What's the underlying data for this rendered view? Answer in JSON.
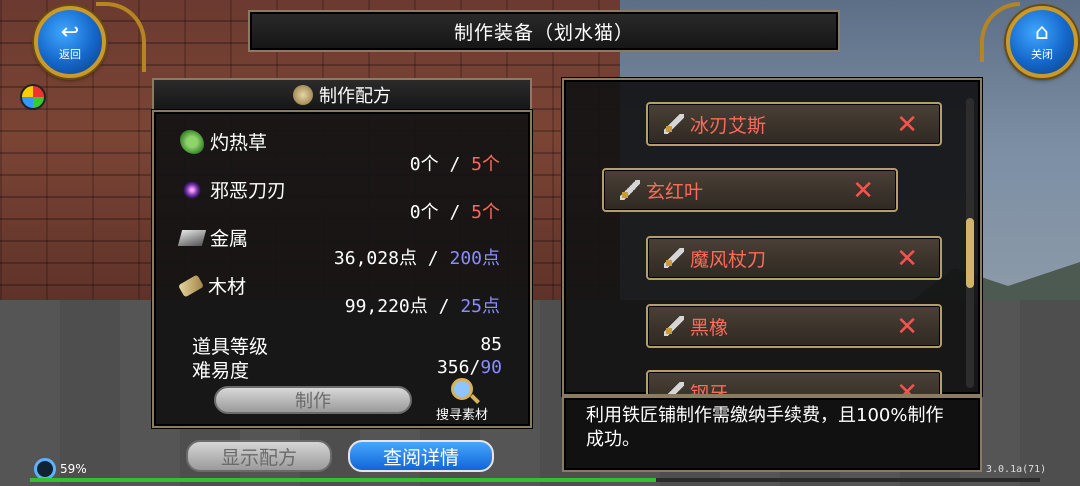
{
  "header": {
    "title": "制作装备（划水猫）"
  },
  "nav": {
    "back_label": "返回",
    "close_label": "关闭"
  },
  "recipe": {
    "title": "制作配方",
    "materials": [
      {
        "name": "灼热草",
        "have": "0个",
        "need": "5个",
        "icon": "herb-icon",
        "need_color": "red"
      },
      {
        "name": "邪恶刀刃",
        "have": "0个",
        "need": "5个",
        "icon": "evil-blade-icon",
        "need_color": "red"
      },
      {
        "name": "金属",
        "have": "36,028点",
        "need": "200点",
        "icon": "metal-icon",
        "need_color": "blue"
      },
      {
        "name": "木材",
        "have": "99,220点",
        "need": "25点",
        "icon": "wood-icon",
        "need_color": "blue"
      }
    ],
    "item_level_label": "道具等级",
    "item_level_value": "85",
    "difficulty_label": "难易度",
    "difficulty_value": "356/",
    "difficulty_max": "90",
    "make_label": "制作",
    "search_label": "搜寻素材",
    "slash": "/"
  },
  "buttons": {
    "show_recipe": "显示配方",
    "view_detail": "查阅详情"
  },
  "equipment_list": [
    {
      "name": "冰刃艾斯",
      "remove": "✕"
    },
    {
      "name": "玄红叶",
      "remove": "✕"
    },
    {
      "name": "魔风杖刀",
      "remove": "✕"
    },
    {
      "name": "黑橡",
      "remove": "✕"
    },
    {
      "name": "钢牙",
      "remove": "✕"
    }
  ],
  "info_text": "利用铁匠铺制作需缴纳手续费，且100%制作成功。",
  "status": {
    "battery": "59%",
    "version": "3.0.1a(71)",
    "exp_progress": 0.62
  },
  "colors": {
    "red": "#ff6a5a",
    "blue": "#8a8cff",
    "gold": "#8a7b63",
    "accent": "#1466c9"
  }
}
